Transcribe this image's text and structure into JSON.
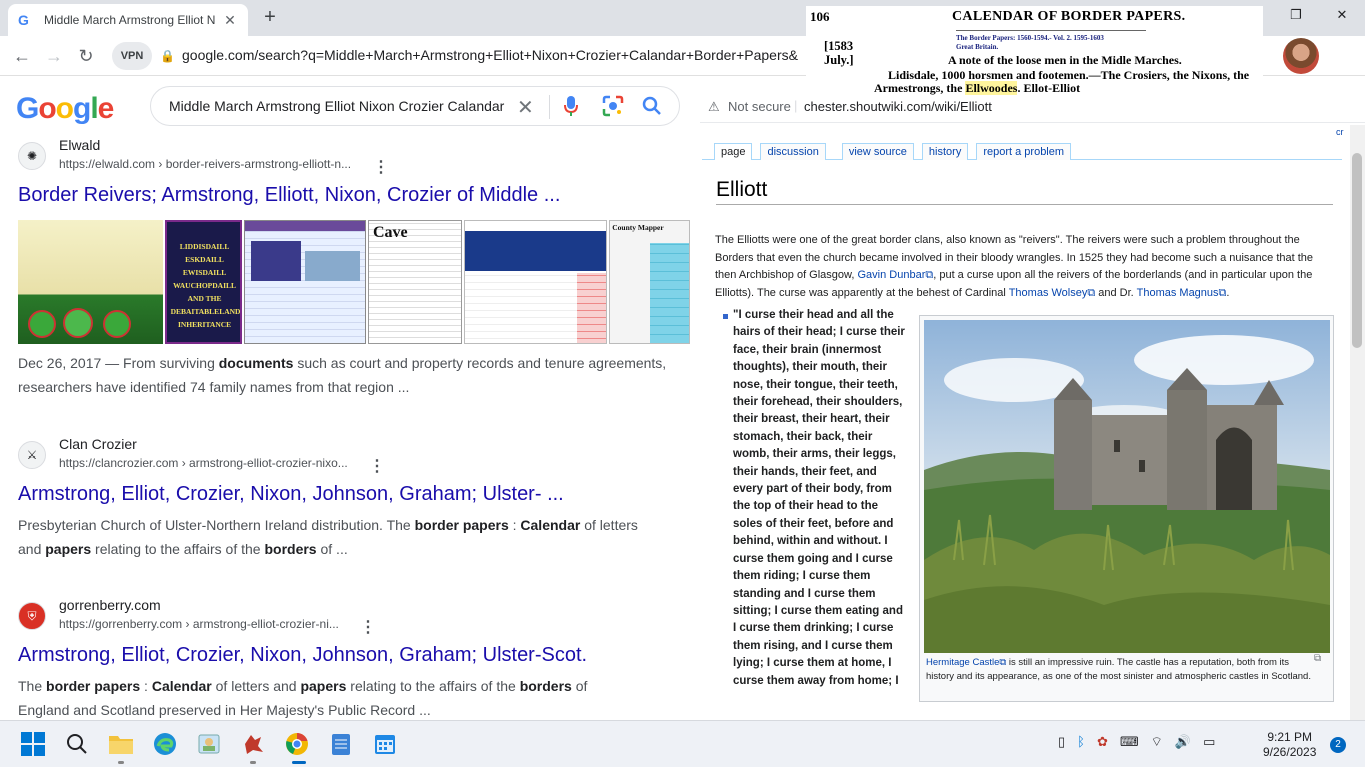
{
  "browser": {
    "tab_title": "Middle March Armstrong Elliot N",
    "url": "google.com/search?q=Middle+March+Armstrong+Elliot+Nixon+Crozier+Calandar+Border+Papers&",
    "vpn_label": "VPN"
  },
  "google": {
    "logo": "Google",
    "query": "Middle March Armstrong Elliot Nixon Crozier Calandar B",
    "results": [
      {
        "site": "Elwald",
        "url": "https://elwald.com › border-reivers-armstrong-elliott-n...",
        "title": "Border Reivers; Armstrong, Elliott, Nixon, Crozier of Middle ...",
        "snippet_date": "Dec 26, 2017 — From surviving ",
        "snippet_b1": "documents",
        "snippet_rest": " such as court and property records and tenure agreements, researchers have identified 74 family names from that region ..."
      },
      {
        "site": "Clan Crozier",
        "url": "https://clancrozier.com › armstrong-elliot-crozier-nixo...",
        "title": "Armstrong, Elliot, Crozier, Nixon, Johnson, Graham; Ulster- ...",
        "s1": "Presbyterian Church of Ulster-Northern Ireland distribution. The ",
        "b1": "border papers",
        "s2": " : ",
        "b2": "Calendar",
        "s3": " of letters and ",
        "b3": "papers",
        "s4": " relating to the affairs of the ",
        "b4": "borders",
        "s5": " of ..."
      },
      {
        "site": "gorrenberry.com",
        "url": "https://gorrenberry.com › armstrong-elliot-crozier-ni...",
        "title": "Armstrong, Elliot, Crozier, Nixon, Johnson, Graham; Ulster-Scot.",
        "s0": "The ",
        "b1": "border papers",
        "s2": " : ",
        "b2": "Calendar",
        "s3": " of letters and ",
        "b3": "papers",
        "s4": " relating to the affairs of the ",
        "b4": "borders",
        "s5": " of England and Scotland preserved in Her Majesty's Public Record ..."
      }
    ],
    "thumb_texts": {
      "t3a": "LIDDISDAILL",
      "t3b": "ESKDAILL",
      "t3c": "EWISDAILL",
      "t3d": "WAUCHOPDAILL",
      "t3e": "AND THE",
      "t3f": "DEBAITABLELAND",
      "t3g": "INHERITANCE",
      "t5": "Cave",
      "t6": "County Mapper"
    }
  },
  "wiki_bar": {
    "warning": "Not secure",
    "url": "chester.shoutwiki.com/wiki/Elliott"
  },
  "wiki": {
    "create": "cr",
    "tabs": [
      "page",
      "discussion",
      "view source",
      "history",
      "report a problem"
    ],
    "title": "Elliott",
    "intro_1": "The Elliotts were one of the great border clans, also known as \"reivers\". The reivers were such a problem throughout the Borders that even the church became involved in their bloody wrangles. In 1525 they had become such a nuisance that the then Archbishop of Glasgow, ",
    "link_dunbar": "Gavin Dunbar",
    "intro_2": ", put a curse upon all the reivers of the borderlands (and in particular upon the Elliotts). The curse was apparently at the behest of Cardinal ",
    "link_wolsey": "Thomas Wolsey",
    "intro_3": " and Dr. ",
    "link_magnus": "Thomas Magnus",
    "intro_4": ".",
    "curse": "\"I curse their head and all the hairs of their head; I curse their face, their brain (innermost thoughts), their mouth, their nose, their tongue, their teeth, their forehead, their shoulders, their breast, their heart, their stomach, their back, their womb, their arms, their leggs, their hands, their feet, and every part of their body, from the top of their head to the soles of their feet, before and behind, within and without. I curse them going and I curse them riding; I curse them standing and I curse them sitting; I curse them eating and I curse them drinking; I curse them rising, and I curse them lying; I curse them at home, I curse them away from home; I",
    "caption_link": "Hermitage Castle",
    "caption_rest": " is still an impressive ruin. The castle has a reputation, both from its history and its appearance, as one of the most sinister and atmospheric castles in Scotland."
  },
  "overlay": {
    "page": "106",
    "header": "CALENDAR OF BORDER PAPERS.",
    "date1": "[1583",
    "date2": "July.]",
    "hl1": "The Border Papers: 1560-1594.- Vol. 2. 1595-1603",
    "hl2": "Great Britain.",
    "line1": "A note of the loose men in the Midle Marches.",
    "line2": "Lidisdale, 1000 horsmen and footemen.—The Crosiers, the Nixons, the",
    "line3a": "Armestrongs, the ",
    "line3b": "Ellwoodes",
    "line3c": ". Ellot-Elliot"
  },
  "taskbar": {
    "time": "9:21 PM",
    "date": "9/26/2023",
    "notifications": "2"
  }
}
